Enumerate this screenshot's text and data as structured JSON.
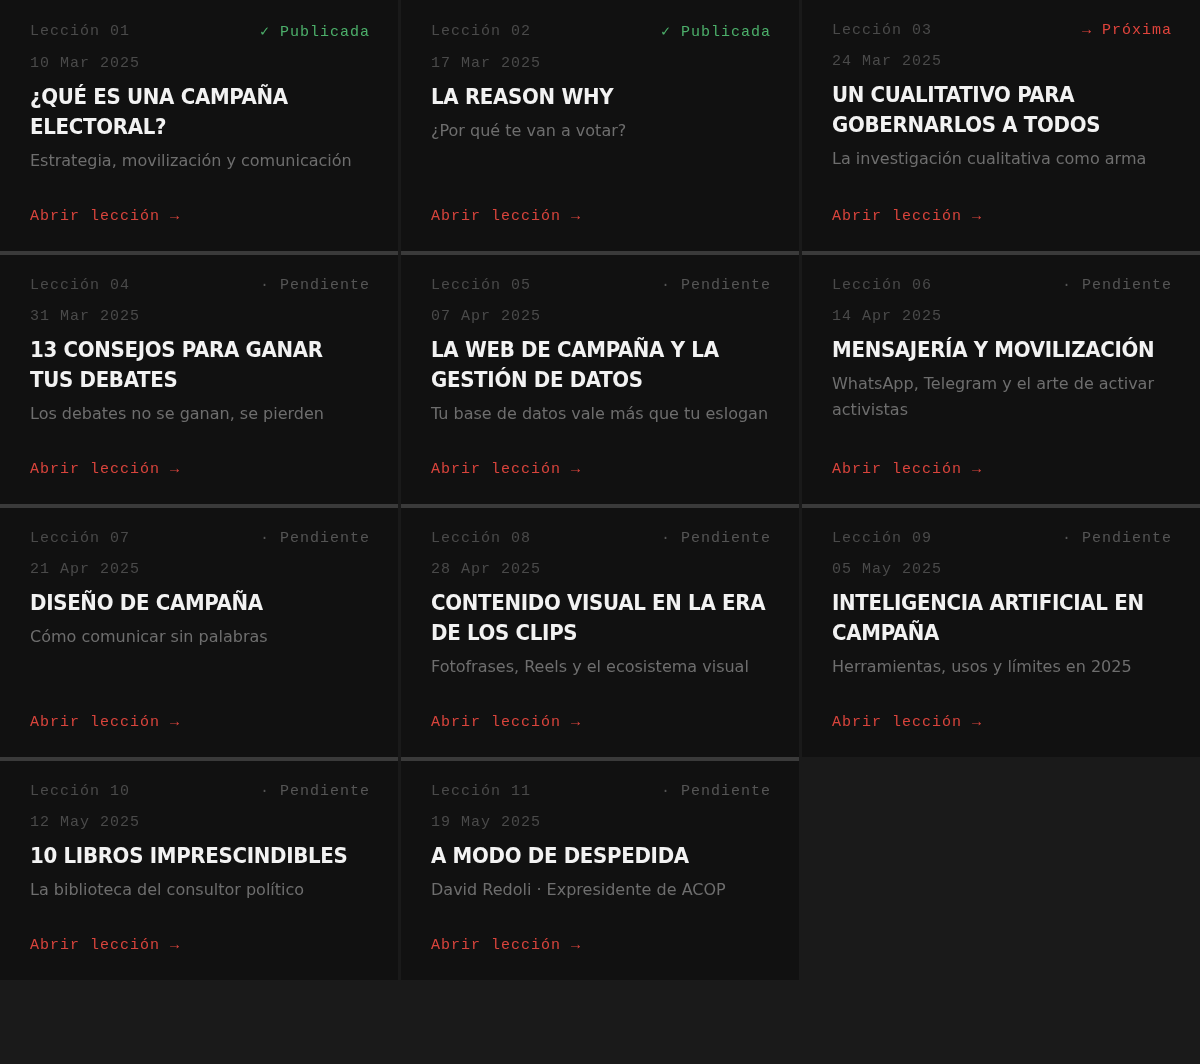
{
  "lessons": [
    {
      "number": "Lección 01",
      "status": {
        "kind": "published",
        "label": "✓ Publicada"
      },
      "date": "10 Mar 2025",
      "title": "¿QUÉ ES UNA CAMPAÑA ELECTORAL?",
      "subtitle": "Estrategia, movilización y comunicación",
      "link": "Abrir lección →"
    },
    {
      "number": "Lección 02",
      "status": {
        "kind": "published",
        "label": "✓ Publicada"
      },
      "date": "17 Mar 2025",
      "title": "LA REASON WHY",
      "subtitle": "¿Por qué te van a votar?",
      "link": "Abrir lección →"
    },
    {
      "number": "Lección 03",
      "status": {
        "kind": "next",
        "label": "→ Próxima"
      },
      "date": "24 Mar 2025",
      "title": "UN CUALITATIVO PARA GOBERNARLOS A TODOS",
      "subtitle": "La investigación cualitativa como arma",
      "link": "Abrir lección →"
    },
    {
      "number": "Lección 04",
      "status": {
        "kind": "pending",
        "label": "· Pendiente"
      },
      "date": "31 Mar 2025",
      "title": "13 CONSEJOS PARA GANAR TUS DEBATES",
      "subtitle": "Los debates no se ganan, se pierden",
      "link": "Abrir lección →"
    },
    {
      "number": "Lección 05",
      "status": {
        "kind": "pending",
        "label": "· Pendiente"
      },
      "date": "07 Apr 2025",
      "title": "LA WEB DE CAMPAÑA Y LA GESTIÓN DE DATOS",
      "subtitle": "Tu base de datos vale más que tu eslogan",
      "link": "Abrir lección →"
    },
    {
      "number": "Lección 06",
      "status": {
        "kind": "pending",
        "label": "· Pendiente"
      },
      "date": "14 Apr 2025",
      "title": "MENSAJERÍA Y MOVILIZACIÓN",
      "subtitle": "WhatsApp, Telegram y el arte de activar activistas",
      "link": "Abrir lección →"
    },
    {
      "number": "Lección 07",
      "status": {
        "kind": "pending",
        "label": "· Pendiente"
      },
      "date": "21 Apr 2025",
      "title": "DISEÑO DE CAMPAÑA",
      "subtitle": "Cómo comunicar sin palabras",
      "link": "Abrir lección →"
    },
    {
      "number": "Lección 08",
      "status": {
        "kind": "pending",
        "label": "· Pendiente"
      },
      "date": "28 Apr 2025",
      "title": "CONTENIDO VISUAL EN LA ERA DE LOS CLIPS",
      "subtitle": "Fotofrases, Reels y el ecosistema visual",
      "link": "Abrir lección →"
    },
    {
      "number": "Lección 09",
      "status": {
        "kind": "pending",
        "label": "· Pendiente"
      },
      "date": "05 May 2025",
      "title": "INTELIGENCIA ARTIFICIAL EN CAMPAÑA",
      "subtitle": "Herramientas, usos y límites en 2025",
      "link": "Abrir lección →"
    },
    {
      "number": "Lección 10",
      "status": {
        "kind": "pending",
        "label": "· Pendiente"
      },
      "date": "12 May 2025",
      "title": "10 LIBROS IMPRESCINDIBLES",
      "subtitle": "La biblioteca del consultor político",
      "link": "Abrir lección →"
    },
    {
      "number": "Lección 11",
      "status": {
        "kind": "pending",
        "label": "· Pendiente"
      },
      "date": "19 May 2025",
      "title": "A MODO DE DESPEDIDA",
      "subtitle": "David Redoli · Expresidente de ACOP",
      "link": "Abrir lección →"
    }
  ]
}
